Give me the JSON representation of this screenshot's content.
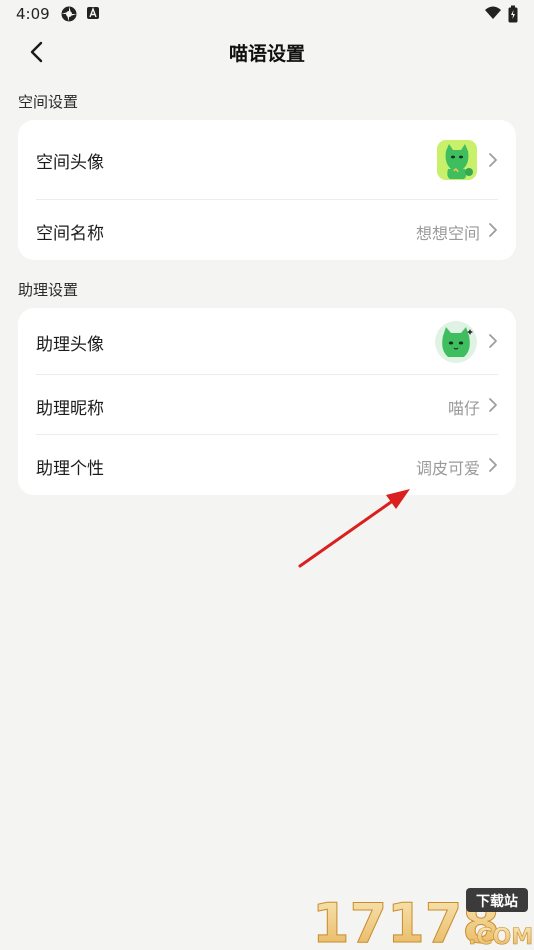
{
  "status_bar": {
    "time": "4:09"
  },
  "header": {
    "title": "喵语设置"
  },
  "sections": {
    "space": {
      "label": "空间设置",
      "avatar_label": "空间头像",
      "name_label": "空间名称",
      "name_value": "想想空间"
    },
    "assistant": {
      "label": "助理设置",
      "avatar_label": "助理头像",
      "nickname_label": "助理昵称",
      "nickname_value": "喵仔",
      "personality_label": "助理个性",
      "personality_value": "调皮可爱"
    }
  },
  "watermark": {
    "brand": "17178",
    "suffix": "下载站",
    "domain": ".COM"
  },
  "colors": {
    "background": "#f4f5f3",
    "card": "#ffffff",
    "accent_green": "#39c46a",
    "annotation_red": "#d9201f"
  },
  "icons": [
    "back-arrow-icon",
    "chevron-right-icon",
    "wifi-icon",
    "battery-icon",
    "settings-gear-icon",
    "app-a-icon"
  ]
}
